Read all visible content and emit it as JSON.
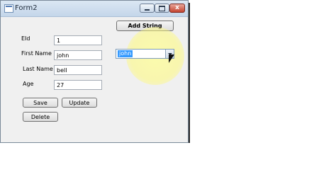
{
  "window": {
    "title": "Form2",
    "close_glyph": "x"
  },
  "form": {
    "eid_label": "EId",
    "eid_value": "1",
    "first_name_label": "First Name",
    "first_name_value": "john",
    "last_name_label": "Last Name",
    "last_name_value": "bell",
    "age_label": "Age",
    "age_value": "27"
  },
  "buttons": {
    "save": "Save",
    "update": "Update",
    "delete": "Delete",
    "add_string": "Add String"
  },
  "combo": {
    "selected": "john"
  },
  "colors": {
    "selection": "#3399ff",
    "cursor_highlight": "#fff99a"
  }
}
